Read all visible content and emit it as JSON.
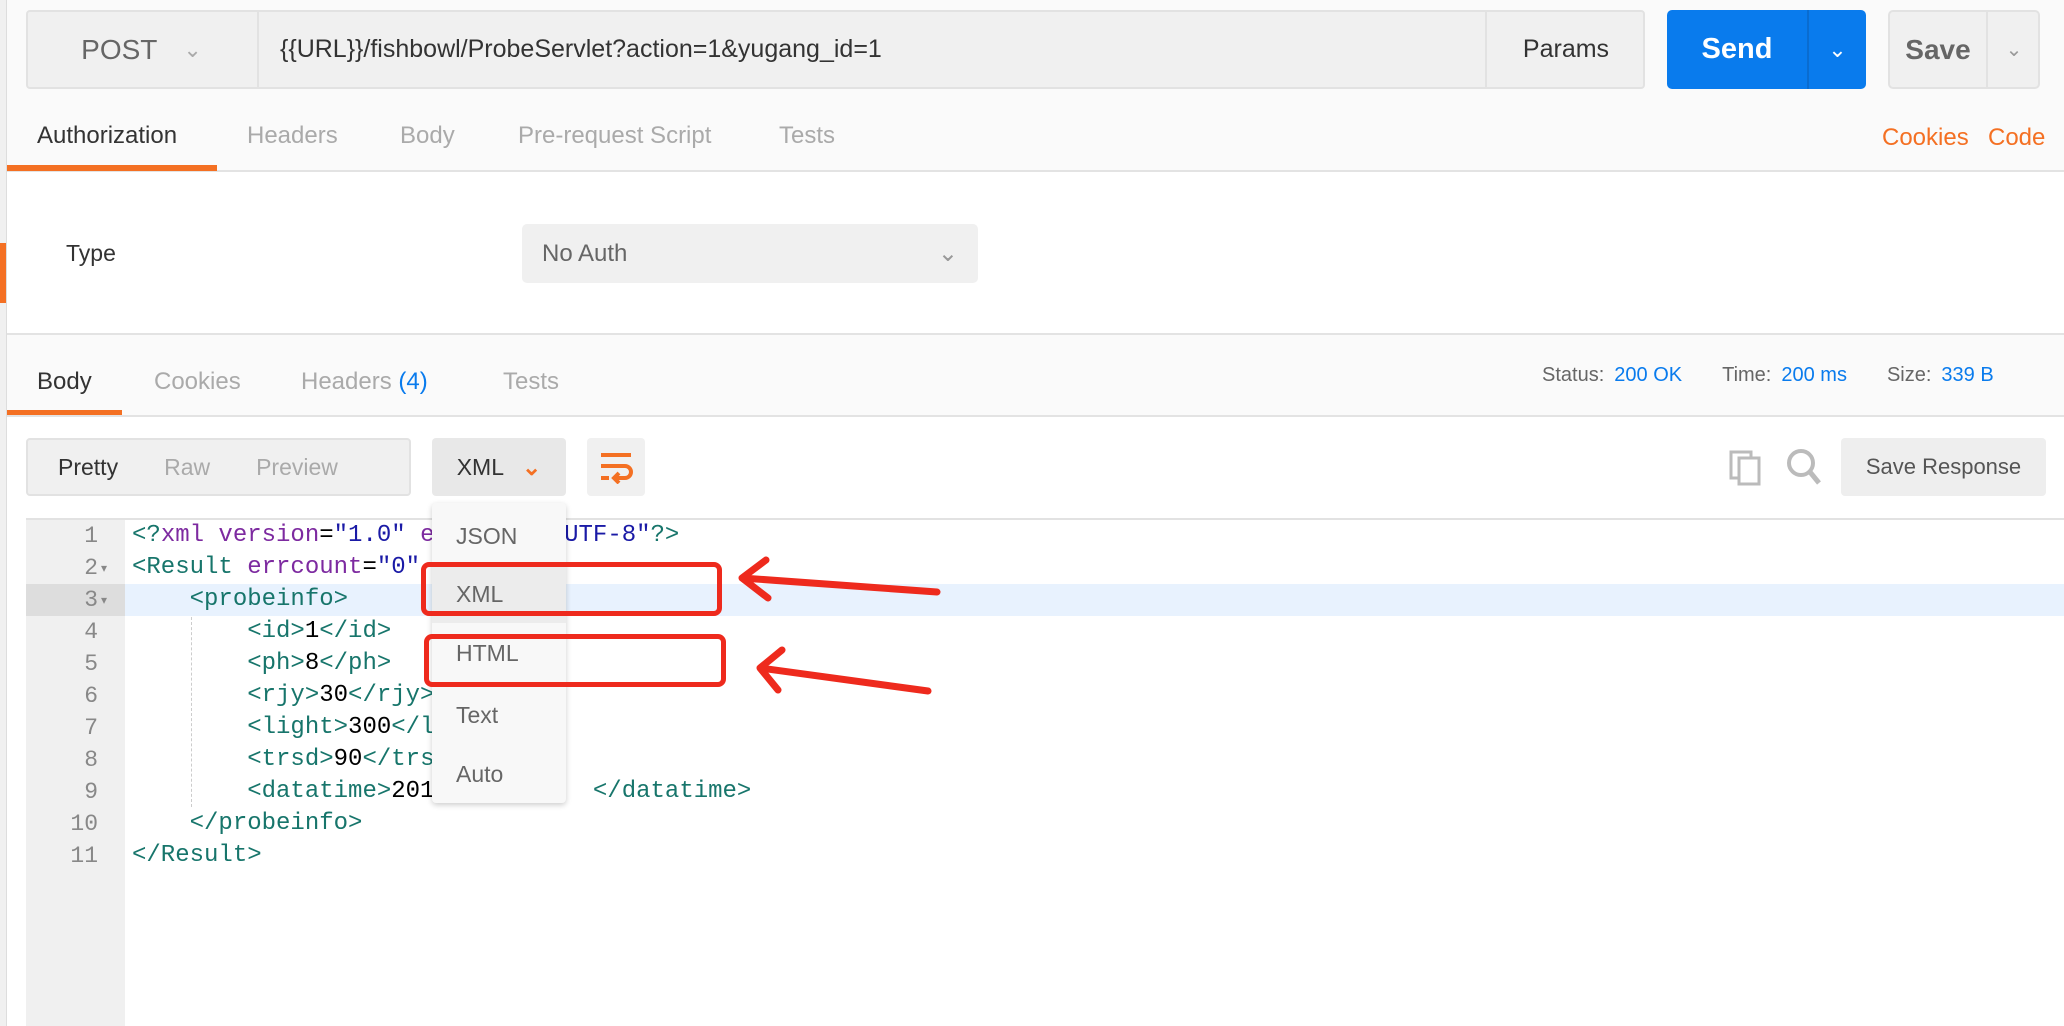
{
  "request": {
    "method": "POST",
    "url": "{{URL}}/fishbowl/ProbeServlet?action=1&yugang_id=1",
    "params_label": "Params",
    "send_label": "Send",
    "save_label": "Save"
  },
  "request_tabs": [
    {
      "label": "Authorization",
      "active": true
    },
    {
      "label": "Headers"
    },
    {
      "label": "Body"
    },
    {
      "label": "Pre-request Script"
    },
    {
      "label": "Tests"
    }
  ],
  "request_links": {
    "cookies": "Cookies",
    "code": "Code"
  },
  "auth": {
    "type_label": "Type",
    "type_value": "No Auth"
  },
  "response_tabs": [
    {
      "label": "Body",
      "active": true
    },
    {
      "label": "Cookies"
    },
    {
      "label": "Headers",
      "count": "(4)"
    },
    {
      "label": "Tests"
    }
  ],
  "status": {
    "status_label": "Status:",
    "status_value": "200 OK",
    "time_label": "Time:",
    "time_value": "200 ms",
    "size_label": "Size:",
    "size_value": "339 B"
  },
  "view_modes": [
    "Pretty",
    "Raw",
    "Preview"
  ],
  "format": {
    "selected": "XML",
    "options": [
      "JSON",
      "XML",
      "HTML",
      "Text",
      "Auto"
    ]
  },
  "save_response_label": "Save Response",
  "code_lines": [
    [
      [
        "t",
        "<?"
      ],
      [
        "a",
        "xml version"
      ],
      [
        "x",
        "="
      ],
      [
        "s",
        "\"1.0\""
      ],
      [
        "a",
        " encoding"
      ],
      [
        "x",
        "="
      ],
      [
        "s",
        "\"UTF-8\""
      ],
      [
        "t",
        "?>"
      ]
    ],
    [
      [
        "t",
        "<Result "
      ],
      [
        "a",
        "errcount"
      ],
      [
        "x",
        "="
      ],
      [
        "s",
        "\"0\""
      ]
    ],
    [
      [
        "t",
        "    <probeinfo>"
      ]
    ],
    [
      [
        "t",
        "        <id>"
      ],
      [
        "x",
        "1"
      ],
      [
        "t",
        "</id>"
      ]
    ],
    [
      [
        "t",
        "        <ph>"
      ],
      [
        "x",
        "8"
      ],
      [
        "t",
        "</ph>"
      ]
    ],
    [
      [
        "t",
        "        <rjy>"
      ],
      [
        "x",
        "30"
      ],
      [
        "t",
        "</rjy>"
      ]
    ],
    [
      [
        "t",
        "        <light>"
      ],
      [
        "x",
        "300"
      ],
      [
        "t",
        "</light>"
      ]
    ],
    [
      [
        "t",
        "        <trsd>"
      ],
      [
        "x",
        "90"
      ],
      [
        "t",
        "</trsd>"
      ]
    ],
    [
      [
        "t",
        "        <datatime>"
      ],
      [
        "x",
        "201"
      ],
      [
        "x",
        "         "
      ],
      [
        "t",
        "  </datatime>"
      ]
    ],
    [
      [
        "t",
        "    </probeinfo>"
      ]
    ],
    [
      [
        "t",
        "</Result>"
      ]
    ]
  ],
  "line_numbers": [
    "1",
    "2",
    "3",
    "4",
    "5",
    "6",
    "7",
    "8",
    "9",
    "10",
    "11"
  ],
  "colors": {
    "accent": "#f47023",
    "primary": "#097bed",
    "annotation": "#ee2a1d"
  }
}
